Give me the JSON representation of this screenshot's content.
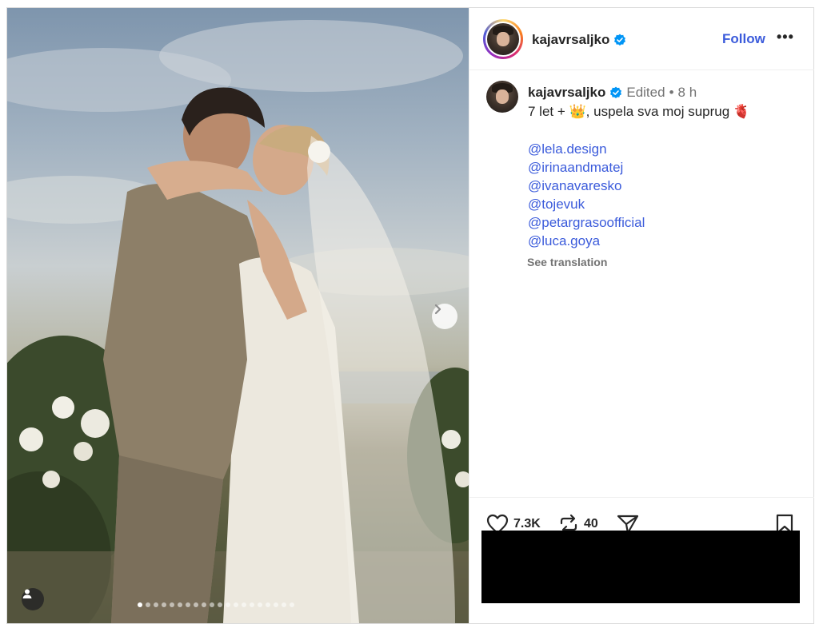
{
  "post": {
    "username": "kajavrsaljko",
    "follow_label": "Follow",
    "more_label": "•••",
    "caption": {
      "username": "kajavrsaljko",
      "edited": "Edited",
      "separator": "•",
      "time": "8 h",
      "text": "7 let + 👑, uspela sva moj suprug 🫀",
      "mentions": [
        "@lela.design",
        "@irinaandmatej",
        "@ivanavaresko",
        "@tojevuk",
        "@petargrasoofficial",
        "@luca.goya"
      ],
      "see_translation": "See translation"
    },
    "actions": {
      "likes": "7.3K",
      "reposts": "40"
    },
    "carousel": {
      "total_slides": 20,
      "current_slide": 1
    },
    "colors": {
      "link": "#3b5bdb",
      "verified": "#0095f6",
      "muted": "#737373"
    }
  }
}
